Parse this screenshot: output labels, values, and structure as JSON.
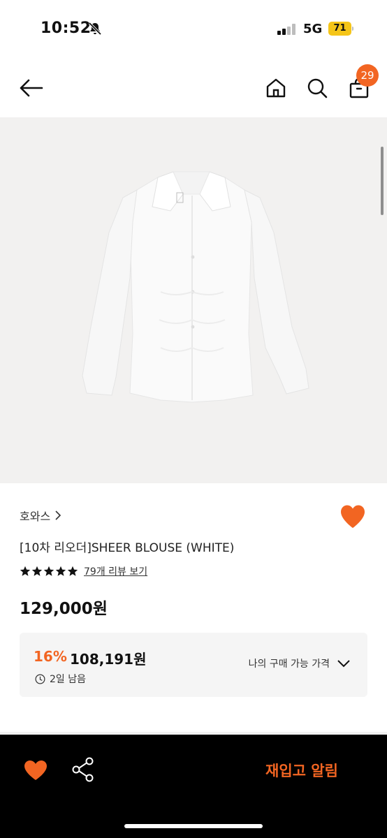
{
  "status_bar": {
    "time": "10:52",
    "network": "5G",
    "battery": "71"
  },
  "header": {
    "cart_count": "29"
  },
  "product": {
    "brand": "호와스",
    "title": "[10차 리오더]SHEER BLOUSE (WHITE)",
    "rating": 5,
    "review_link": "79개 리뷰 보기",
    "price": "129,000원",
    "discount": {
      "percent": "16%",
      "price": "108,191원",
      "time_left": "2일 남음",
      "my_price_label": "나의 구매 가능 가격"
    }
  },
  "bottom_bar": {
    "restock_label": "재입고 알림"
  },
  "colors": {
    "accent": "#f26522",
    "battery": "#f5c518"
  }
}
